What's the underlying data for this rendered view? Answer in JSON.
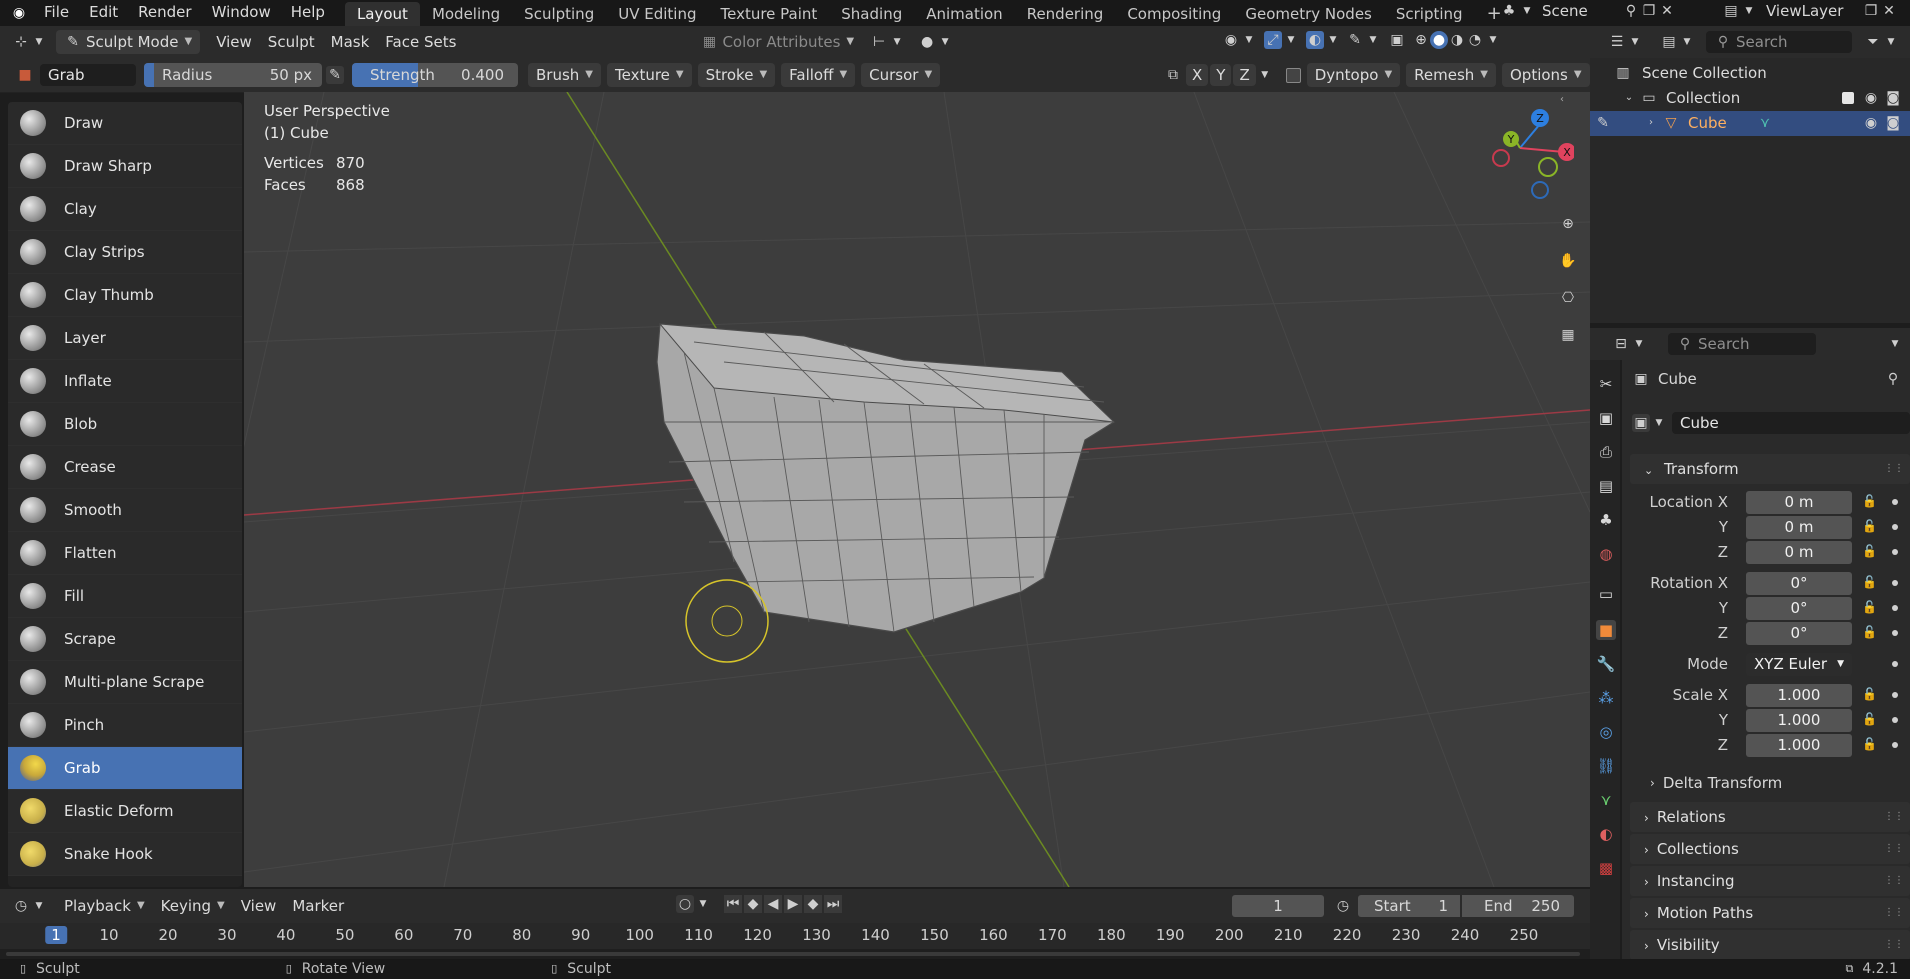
{
  "menubar": {
    "menus": [
      "File",
      "Edit",
      "Render",
      "Window",
      "Help"
    ],
    "workspaces": [
      "Layout",
      "Modeling",
      "Sculpting",
      "UV Editing",
      "Texture Paint",
      "Shading",
      "Animation",
      "Rendering",
      "Compositing",
      "Geometry Nodes",
      "Scripting"
    ],
    "active_workspace": "Layout",
    "add_tab": "+",
    "scene_label": "Scene",
    "viewlayer_label": "ViewLayer"
  },
  "header": {
    "mode": "Sculpt Mode",
    "menus": [
      "View",
      "Sculpt",
      "Mask",
      "Face Sets"
    ],
    "color_attributes": "Color Attributes"
  },
  "toolsettings": {
    "brush_name": "Grab",
    "radius_label": "Radius",
    "radius_value": "50 px",
    "strength_label": "Strength",
    "strength_value": "0.400",
    "strength_fraction": 0.4,
    "dropdowns": [
      "Brush",
      "Texture",
      "Stroke",
      "Falloff",
      "Cursor"
    ],
    "symmetry": [
      "X",
      "Y",
      "Z"
    ],
    "dyntopo": "Dyntopo",
    "remesh": "Remesh",
    "options": "Options"
  },
  "viewport": {
    "perspective": "User Perspective",
    "object": "(1) Cube",
    "stats": [
      {
        "label": "Vertices",
        "value": "870"
      },
      {
        "label": "Faces",
        "value": "868"
      }
    ],
    "gizmo": {
      "x": "X",
      "y": "Y",
      "z": "Z"
    },
    "colors": {
      "x_axis": "#e0435e",
      "y_axis": "#8ab527",
      "z_axis": "#2d7fe0",
      "brush_circle": "#d6c42a"
    }
  },
  "tools": [
    {
      "name": "Draw"
    },
    {
      "name": "Draw Sharp"
    },
    {
      "name": "Clay"
    },
    {
      "name": "Clay Strips"
    },
    {
      "name": "Clay Thumb"
    },
    {
      "name": "Layer"
    },
    {
      "name": "Inflate"
    },
    {
      "name": "Blob"
    },
    {
      "name": "Crease"
    },
    {
      "name": "Smooth"
    },
    {
      "name": "Flatten"
    },
    {
      "name": "Fill"
    },
    {
      "name": "Scrape"
    },
    {
      "name": "Multi-plane Scrape"
    },
    {
      "name": "Pinch"
    },
    {
      "name": "Grab",
      "active": true
    },
    {
      "name": "Elastic Deform"
    },
    {
      "name": "Snake Hook"
    }
  ],
  "outliner": {
    "search_placeholder": "Search",
    "scene_collection": "Scene Collection",
    "collection": "Collection",
    "cube": "Cube"
  },
  "properties": {
    "search_placeholder": "Search",
    "object_title": "Cube",
    "object_name": "Cube",
    "transform_label": "Transform",
    "location_label": "Location X",
    "rotation_label": "Rotation X",
    "scale_label": "Scale X",
    "y_label": "Y",
    "z_label": "Z",
    "location": [
      "0 m",
      "0 m",
      "0 m"
    ],
    "rotation": [
      "0°",
      "0°",
      "0°"
    ],
    "mode_label": "Mode",
    "mode_value": "XYZ Euler",
    "scale": [
      "1.000",
      "1.000",
      "1.000"
    ],
    "delta_transform": "Delta Transform",
    "sections": [
      "Relations",
      "Collections",
      "Instancing",
      "Motion Paths",
      "Visibility"
    ]
  },
  "timeline": {
    "menus": [
      "Playback",
      "Keying",
      "View",
      "Marker"
    ],
    "current_frame": "1",
    "start_label": "Start",
    "start_value": "1",
    "end_label": "End",
    "end_value": "250",
    "ticks": [
      "1",
      "10",
      "20",
      "30",
      "40",
      "50",
      "60",
      "70",
      "80",
      "90",
      "100",
      "110",
      "120",
      "130",
      "140",
      "150",
      "160",
      "170",
      "180",
      "190",
      "200",
      "210",
      "220",
      "230",
      "240",
      "250"
    ]
  },
  "statusbar": {
    "left": "Sculpt",
    "middle": "Rotate View",
    "right": "Sculpt",
    "version": "4.2.1"
  }
}
